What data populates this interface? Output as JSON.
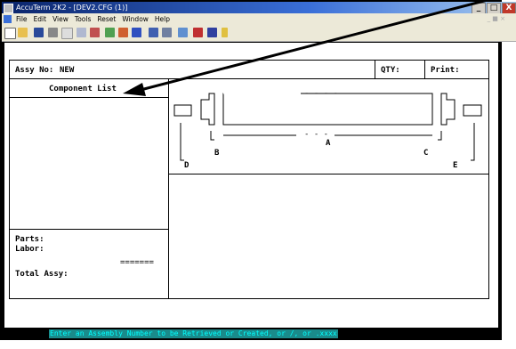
{
  "window": {
    "title": "AccuTerm 2K2 - [DEV2.CFG (1)]",
    "min": "_",
    "max": "□",
    "close": "X"
  },
  "menu": [
    "File",
    "Edit",
    "View",
    "Tools",
    "Reset",
    "Window",
    "Help"
  ],
  "mdi_controls": "_ ■ ×",
  "toolbar_icons": [
    "new-icon",
    "open-icon",
    "save-icon",
    "print-icon",
    "print-preview-icon",
    "copy-icon",
    "paste-icon",
    "check-icon",
    "connect-icon",
    "disconnect-icon",
    "terminal-icon",
    "settings-icon",
    "macro-icon",
    "keyboard-icon",
    "capture-icon",
    "help-icon"
  ],
  "form": {
    "assy_label": "Assy No:",
    "assy_value": "NEW",
    "qty_label": "QTY:",
    "print_label": "Print:",
    "component_list_label": "Component List",
    "parts_label": "Parts:",
    "labor_label": "Labor:",
    "separator": "=======",
    "total_label": "Total Assy:"
  },
  "diagram": {
    "label_a": "A",
    "label_b": "B",
    "label_c": "C",
    "label_d": "D",
    "label_e": "E",
    "dash_top": "- - - -",
    "dash_mid": "- - -"
  },
  "status_message": "Enter an Assembly Number to be Retrieved or Created, or /, or .xxxx"
}
